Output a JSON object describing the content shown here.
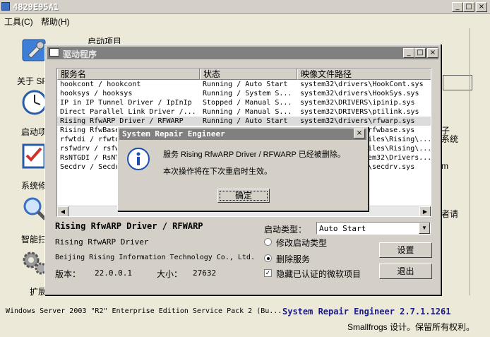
{
  "main_window": {
    "title": "4829E95A1",
    "menu": [
      "工具(C)",
      "帮助(H)"
    ],
    "partial_label": "启动项目",
    "sidebar": [
      {
        "label": "关于 SRE",
        "icon": "wrench-icon"
      },
      {
        "label": "启动项",
        "icon": "clock-icon"
      },
      {
        "label": "系统修",
        "icon": "checklist-icon"
      },
      {
        "label": "智能扫",
        "icon": "magnifier-icon"
      },
      {
        "label": "扩展",
        "icon": "gears-icon"
      }
    ],
    "right_fragments": {
      "line1": "子",
      "line2": "系统",
      "line3": "m",
      "line4": "者请"
    }
  },
  "driver_dialog": {
    "title": "驱动程序",
    "columns": [
      "服务名",
      "状态",
      "映像文件路径"
    ],
    "rows": [
      {
        "name": "hookcont / hookcont",
        "status": "Running / Auto Start",
        "path": "system32\\drivers\\HookCont.sys"
      },
      {
        "name": "hooksys / hooksys",
        "status": "Running / System S...",
        "path": "system32\\drivers\\HookSys.sys"
      },
      {
        "name": "IP in IP Tunnel Driver / IpInIp",
        "status": "Stopped / Manual S...",
        "path": "system32\\DRIVERS\\ipinip.sys"
      },
      {
        "name": "Direct Parallel Link Driver /...",
        "status": "Running / Manual S...",
        "path": "system32\\DRIVERS\\ptilink.sys"
      },
      {
        "name": "Rising RfwARP Driver / RFWARP",
        "status": "Running / Auto Start",
        "path": "system32\\drivers\\rfwarp.sys"
      },
      {
        "name": "Rising RfwBase",
        "status": "",
        "path": "rfwbase.sys"
      },
      {
        "name": "rfwtdi / rfwtd",
        "status": "",
        "path": "iles\\Rising\\..."
      },
      {
        "name": "rsfwdrv / rsfw",
        "status": "",
        "path": "iles\\Rising\\..."
      },
      {
        "name": "RsNTGDI / RsNT",
        "status": "",
        "path": "em32\\Drivers..."
      },
      {
        "name": "Secdrv / Secdr",
        "status": "",
        "path": "\\secdrv.sys"
      }
    ],
    "selected_row": 4,
    "detail": {
      "name": "Rising RfwARP Driver / RFWARP",
      "description": "Rising RfwARP Driver",
      "company": "Beijing Rising Information Technology Co., Ltd.",
      "version_label": "版本：",
      "version": "22.0.0.1",
      "size_label": "大小：",
      "size": "27632"
    },
    "startup_type_label": "启动类型：",
    "startup_type_value": "Auto Start",
    "radio_modify": "修改启动类型",
    "radio_delete": "删除服务",
    "checkbox_hide": "隐藏已认证的微软项目",
    "settings_button": "设置",
    "exit_button": "退出"
  },
  "message_box": {
    "title": "System Repair Engineer",
    "line1": "服务 Rising RfwARP Driver / RFWARP 已经被删除。",
    "line2": "本次操作将在下次重启时生效。",
    "ok_button": "确定"
  },
  "status_bar": {
    "os_info": "Windows Server 2003 \"R2\" Enterprise Edition Service Pack 2 (Bu...",
    "app_name": "System Repair Engineer 2.7.1.1261",
    "copyright": "Smallfrogs 设计。保留所有权利。"
  },
  "colors": {
    "app_name": "#1a1a8c",
    "face": "#d4d0c8",
    "title_inactive": "#808080"
  }
}
